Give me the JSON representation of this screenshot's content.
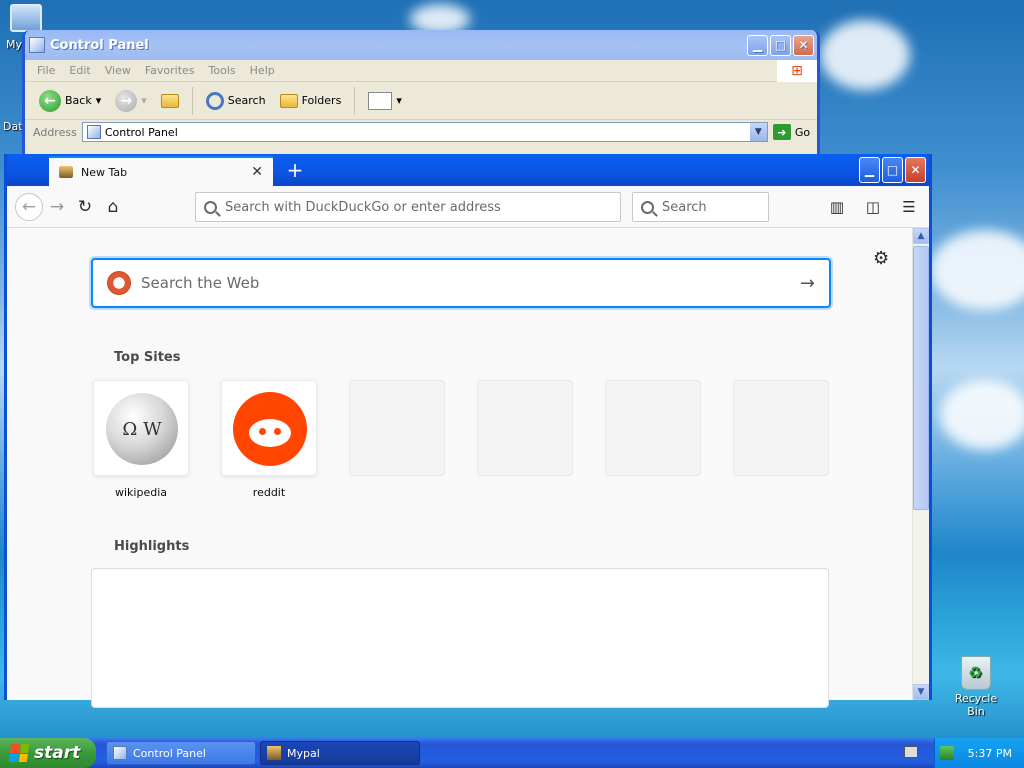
{
  "desktop": {
    "my_computer_label": "My",
    "side_label": "Dat",
    "recycle_bin_label": "Recycle Bin"
  },
  "control_panel": {
    "title": "Control Panel",
    "menu": [
      "File",
      "Edit",
      "View",
      "Favorites",
      "Tools",
      "Help"
    ],
    "toolbar": {
      "back": "Back",
      "search": "Search",
      "folders": "Folders"
    },
    "address_label": "Address",
    "address_value": "Control Panel",
    "go_label": "Go"
  },
  "firefox": {
    "tab_title": "New Tab",
    "url_placeholder": "Search with DuckDuckGo or enter address",
    "search_placeholder": "Search",
    "web_search_placeholder": "Search the Web",
    "top_sites_title": "Top Sites",
    "highlights_title": "Highlights",
    "top_sites": [
      {
        "label": "wikipedia"
      },
      {
        "label": "reddit"
      }
    ]
  },
  "taskbar": {
    "start_label": "start",
    "tasks": [
      "Control Panel",
      "Mypal"
    ],
    "clock": "5:37 PM"
  }
}
